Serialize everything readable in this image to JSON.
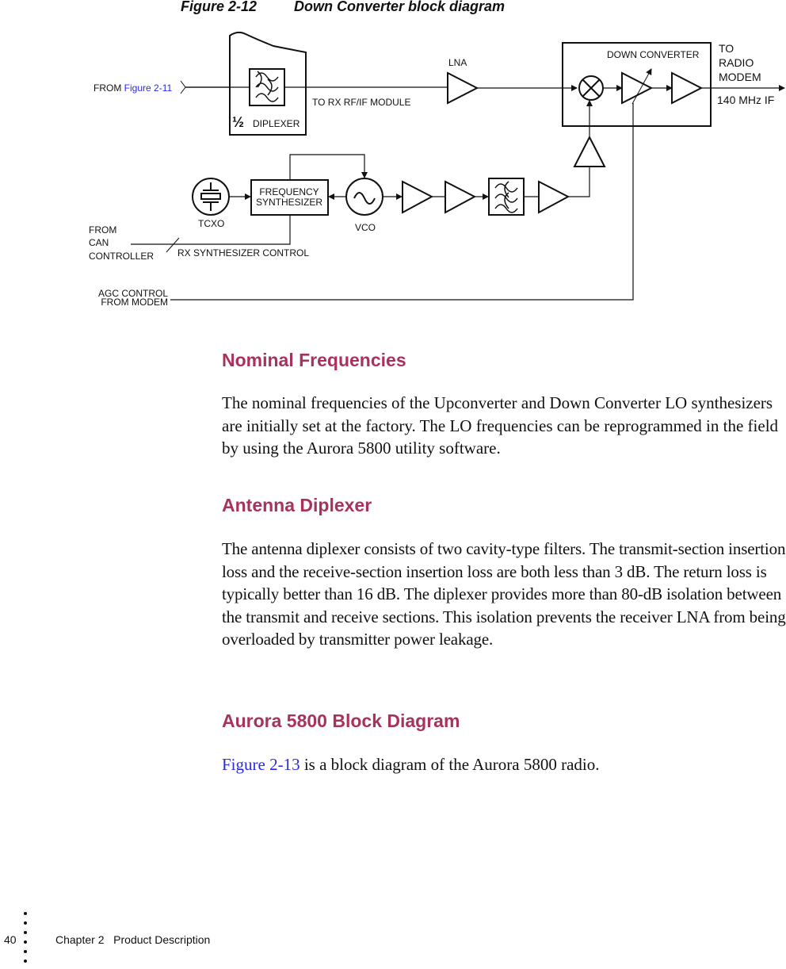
{
  "figure": {
    "number": "Figure 2-12",
    "title": "Down Converter block diagram",
    "labels": {
      "from_prefix": "FROM ",
      "from_link": "Figure 2-11",
      "diplexer_fraction": "½",
      "diplexer": "DIPLEXER",
      "to_rx_module": "TO RX RF/IF MODULE",
      "lna": "LNA",
      "down_converter": "DOWN CONVERTER",
      "to_line1": "TO",
      "to_line2": "RADIO",
      "to_line3": "MODEM",
      "if_freq": "140 MHz IF",
      "synth_line1": "FREQUENCY",
      "synth_line2": "SYNTHESIZER",
      "tcxo": "TCXO",
      "vco": "VCO",
      "from_can_1": "FROM",
      "from_can_2": "CAN",
      "from_can_3": "CONTROLLER",
      "rx_synth_control": "RX SYNTHESIZER CONTROL",
      "agc_1": "AGC CONTROL",
      "agc_2": "FROM MODEM"
    }
  },
  "sections": [
    {
      "heading": "Nominal Frequencies",
      "body": "The nominal frequencies of the Upconverter and Down Converter LO synthesizers are initially set at the factory. The LO frequencies can be reprogrammed in the field by using the Aurora 5800 utility software."
    },
    {
      "heading": "Antenna Diplexer",
      "body": "The antenna diplexer consists of two cavity-type filters. The transmit-section insertion loss and the receive-section insertion loss are both less than 3 dB. The return loss is typically better than 16 dB. The diplexer provides more than 80-dB isolation between the transmit and receive sections. This isolation prevents the receiver LNA from being overloaded by transmitter power leakage."
    },
    {
      "heading": "Aurora 5800 Block Diagram",
      "body_link": "Figure 2-13",
      "body_rest": " is a block diagram of the Aurora 5800 radio."
    }
  ],
  "footer": {
    "page_number": "40",
    "chapter": "Chapter 2   Product Description"
  },
  "colors": {
    "heading": "#a8325e",
    "link": "#2a2ae0"
  }
}
